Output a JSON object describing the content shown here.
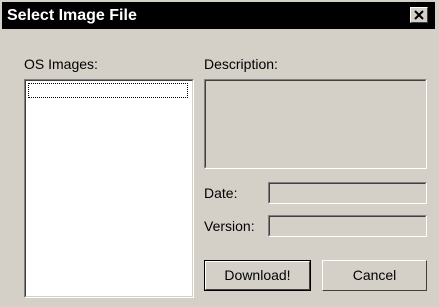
{
  "window": {
    "title": "Select Image File",
    "close_icon": "close-x-icon"
  },
  "os_images": {
    "label": "OS Images:",
    "items": []
  },
  "description": {
    "label": "Description:",
    "value": ""
  },
  "date": {
    "label": "Date:",
    "value": ""
  },
  "version": {
    "label": "Version:",
    "value": ""
  },
  "buttons": {
    "download": "Download!",
    "cancel": "Cancel"
  },
  "colors": {
    "titlebar": "#000000",
    "face": "#d4d0c8",
    "list_background": "#ffffff"
  }
}
